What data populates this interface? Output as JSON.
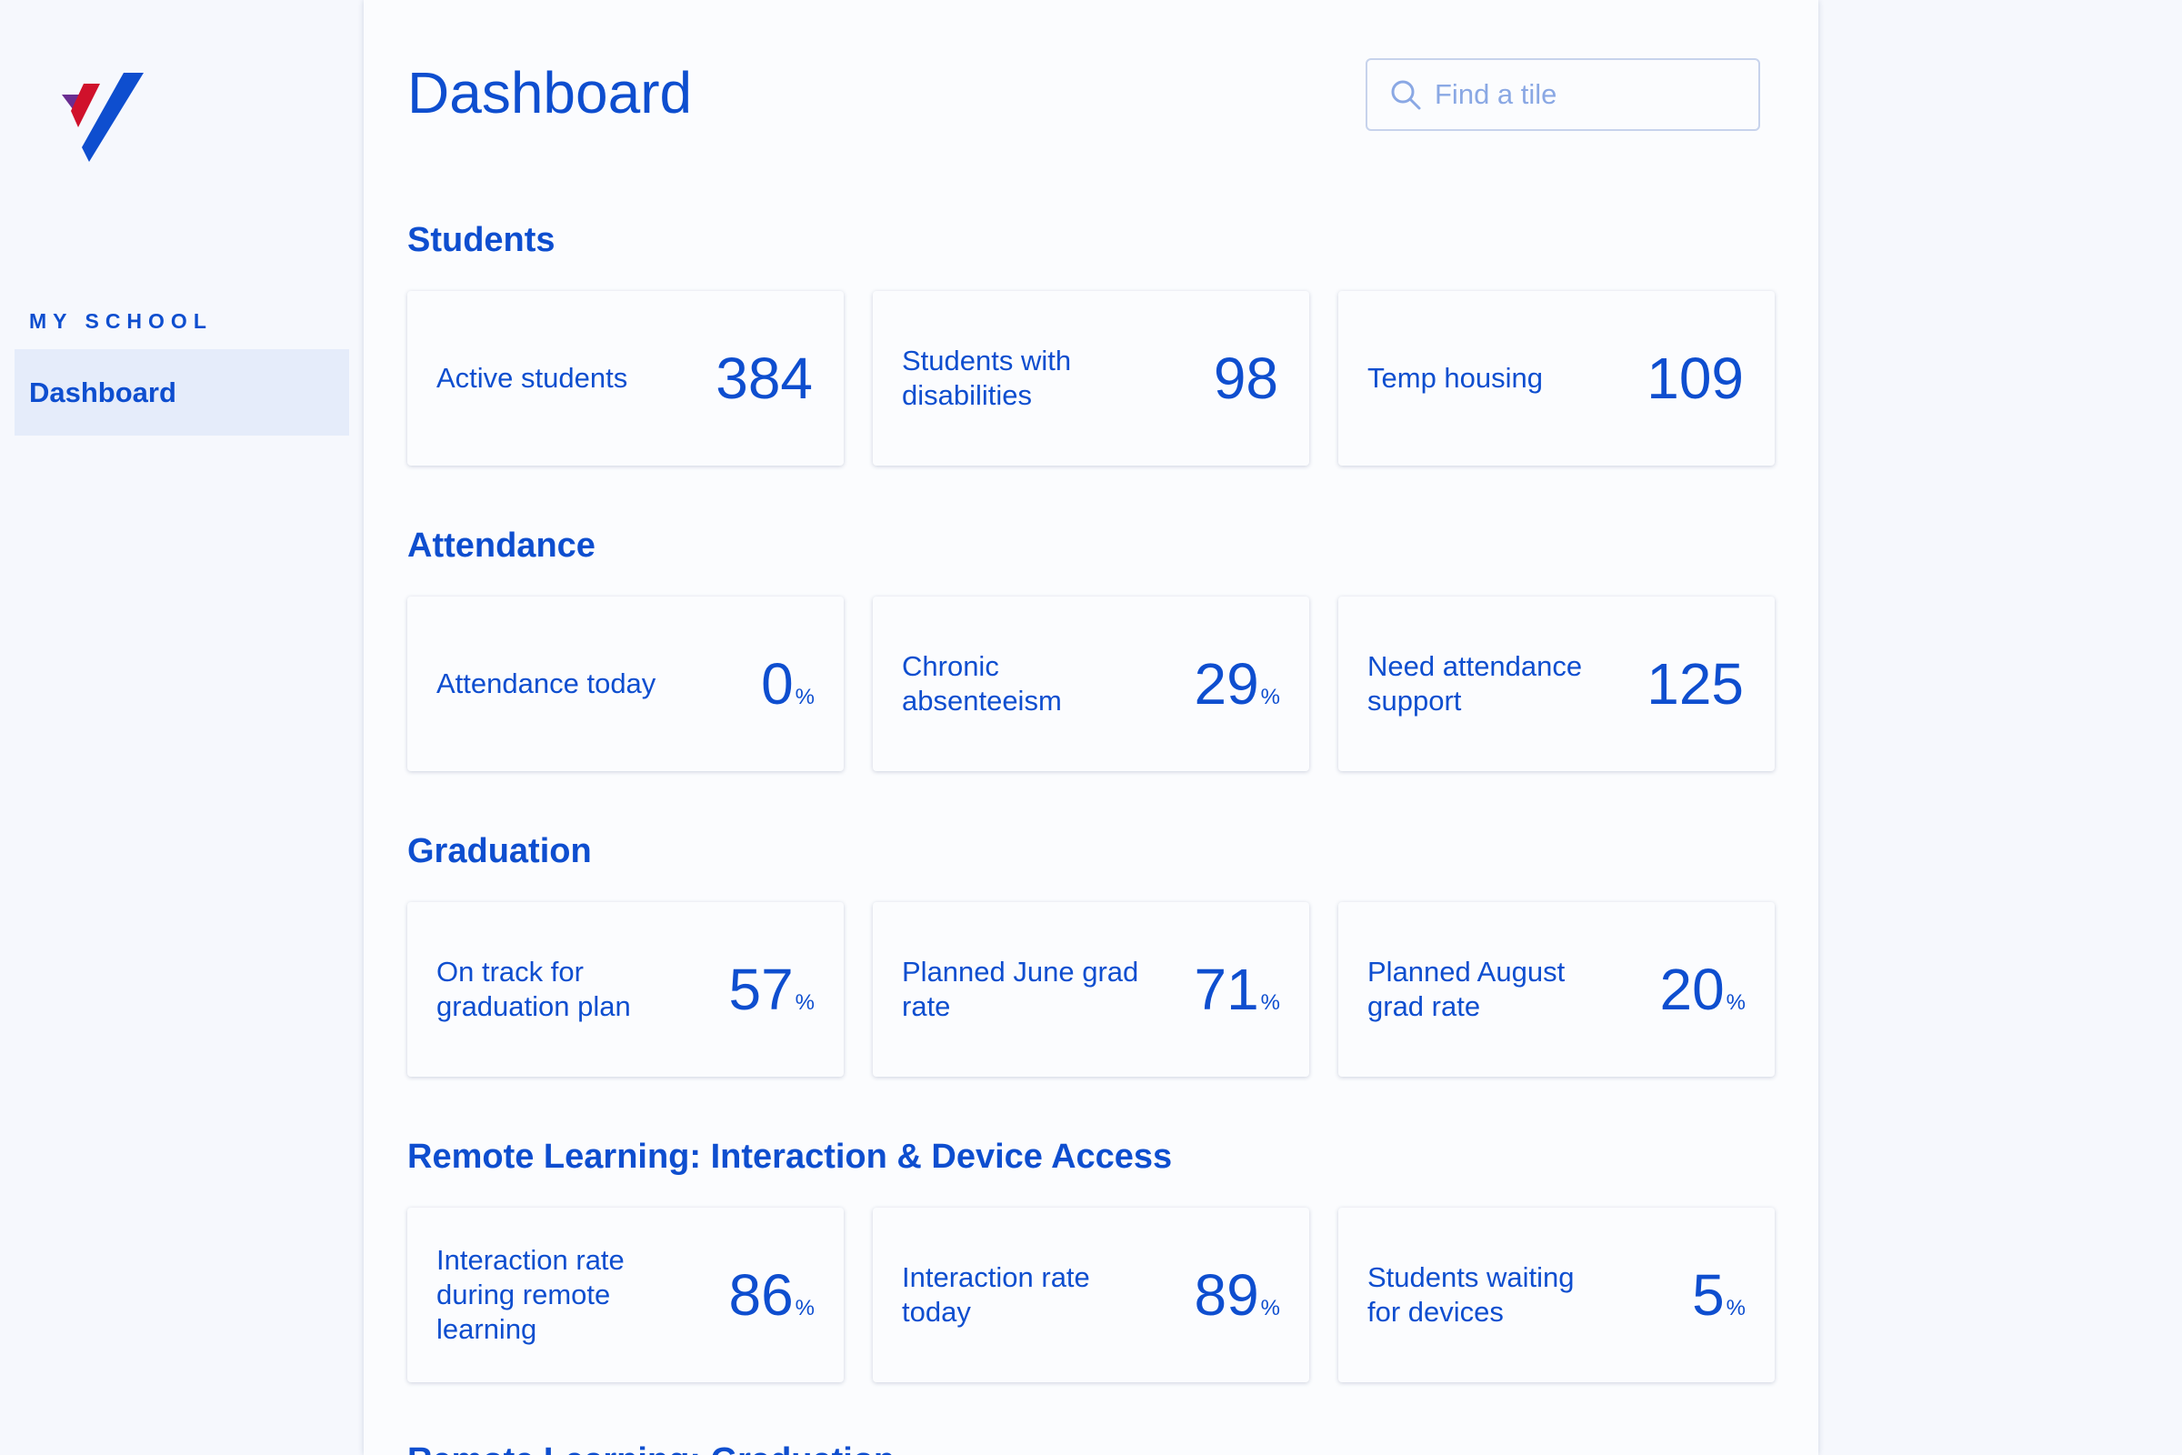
{
  "sidebar": {
    "logo": "app-logo",
    "section_label": "MY SCHOOL",
    "items": [
      {
        "label": "Dashboard",
        "active": true
      }
    ]
  },
  "header": {
    "title": "Dashboard",
    "search": {
      "placeholder": "Find a tile",
      "value": "",
      "icon": "search-icon"
    }
  },
  "sections": [
    {
      "title": "Students",
      "tiles": [
        {
          "label": "Active students",
          "value": "384",
          "unit": ""
        },
        {
          "label": "Students with disabilities",
          "value": "98",
          "unit": ""
        },
        {
          "label": "Temp housing",
          "value": "109",
          "unit": ""
        }
      ]
    },
    {
      "title": "Attendance",
      "tiles": [
        {
          "label": "Attendance today",
          "value": "0",
          "unit": "%"
        },
        {
          "label": "Chronic absenteeism",
          "value": "29",
          "unit": "%"
        },
        {
          "label": "Need attendance support",
          "value": "125",
          "unit": ""
        }
      ]
    },
    {
      "title": "Graduation",
      "tiles": [
        {
          "label": "On track for graduation plan",
          "value": "57",
          "unit": "%"
        },
        {
          "label": "Planned June grad rate",
          "value": "71",
          "unit": "%"
        },
        {
          "label": "Planned August grad rate",
          "value": "20",
          "unit": "%"
        }
      ]
    },
    {
      "title": "Remote Learning: Interaction & Device Access",
      "tiles": [
        {
          "label": "Interaction rate during remote learning",
          "value": "86",
          "unit": "%"
        },
        {
          "label": "Interaction rate today",
          "value": "89",
          "unit": "%"
        },
        {
          "label": "Students waiting for devices",
          "value": "5",
          "unit": "%"
        }
      ]
    }
  ],
  "partial_section_title": "Remote Learning: Graduation",
  "colors": {
    "accent": "#0e4ecf",
    "nav_active_bg": "#e5ecfa",
    "background": "#f6f8fd",
    "logo_purple": "#6a2d91",
    "logo_red": "#d0112b",
    "logo_blue": "#0e4ecf"
  }
}
